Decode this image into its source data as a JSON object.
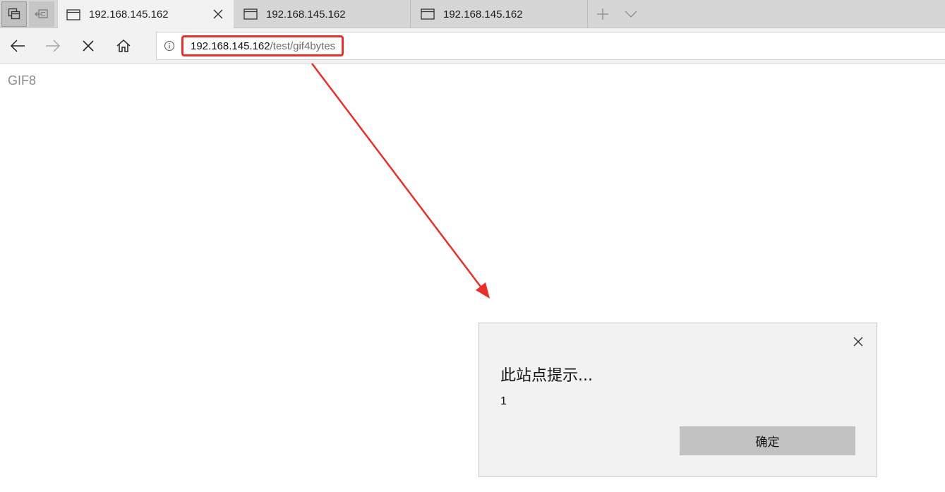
{
  "tabs": [
    {
      "title": "192.168.145.162",
      "active": true
    },
    {
      "title": "192.168.145.162",
      "active": false
    },
    {
      "title": "192.168.145.162",
      "active": false
    }
  ],
  "icons": {
    "tabs_aside": "tabs-aside-icon",
    "set_aside": "set-aside-tabs-icon",
    "tab_page": "page-icon",
    "close": "close-icon",
    "new_tab": "plus-icon",
    "tab_menu": "chevron-down-icon",
    "back": "back-arrow-icon",
    "forward": "forward-arrow-icon",
    "stop": "stop-icon",
    "home": "home-icon",
    "info": "info-icon"
  },
  "address": {
    "host": "192.168.145.162",
    "path": "/test/gif4bytes"
  },
  "page": {
    "body_text": "GIF8"
  },
  "dialog": {
    "title": "此站点提示...",
    "message": "1",
    "ok_label": "确定"
  },
  "colors": {
    "annotation_red": "#e8302a",
    "tabstrip_bg": "#d6d6d6",
    "dialog_bg": "#f2f2f2",
    "button_bg": "#c2c2c2"
  }
}
